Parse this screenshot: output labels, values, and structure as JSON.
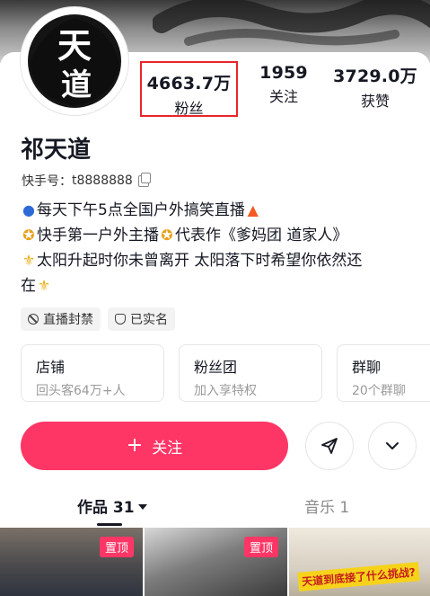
{
  "stats": {
    "fans_value": "4663.7万",
    "fans_label": "粉丝",
    "following_value": "1959",
    "following_label": "关注",
    "likes_value": "3729.0万",
    "likes_label": "获赞"
  },
  "profile": {
    "name": "祁天道",
    "kuaishou_id_label": "快手号：",
    "kuaishou_id": "t8888888",
    "avatar_text_top": "天",
    "avatar_text_bottom": "道"
  },
  "bio": {
    "line1": "每天下午5点全国户外搞笑直播",
    "line2a": "快手第一户外主播",
    "line2b": "代表作《爹妈团  道家人》",
    "line3": "太阳升起时你未曾离开 太阳落下时希望你依然还",
    "line4": "在"
  },
  "tags": [
    {
      "label": "直播封禁",
      "icon": "ban-icon"
    },
    {
      "label": "已实名",
      "icon": "shield-icon"
    }
  ],
  "cards": [
    {
      "title": "店铺",
      "subtitle": "回头客64万+人"
    },
    {
      "title": "粉丝团",
      "subtitle": "加入享特权"
    },
    {
      "title": "群聊",
      "subtitle": "20个群聊"
    }
  ],
  "actions": {
    "follow_label": "关注"
  },
  "tabs": {
    "works_label": "作品 31",
    "music_label": "音乐 1"
  },
  "thumbnails": [
    {
      "badge": "置顶"
    },
    {
      "badge": "置顶"
    },
    {
      "caption": "天道到底接了什么挑战?"
    }
  ],
  "colors": {
    "accent": "#fe3666",
    "highlight_border": "#e8262c"
  }
}
